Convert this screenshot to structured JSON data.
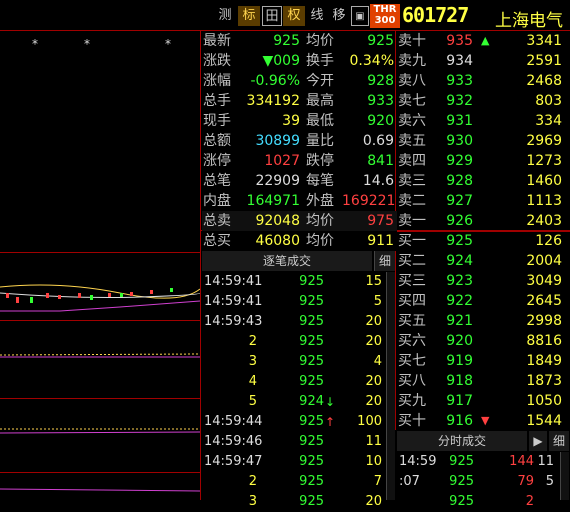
{
  "toolbar": {
    "buttons": [
      "测",
      "标",
      "田",
      "权",
      "线",
      "移",
      "▣",
      "▣"
    ],
    "index_badge": "THR\n300",
    "code": "601727",
    "name": "上海电气"
  },
  "chart": {
    "markers": [
      "*",
      "*",
      "*"
    ]
  },
  "quote_left": [
    {
      "l1": "最新",
      "v1": "925",
      "c1": "green",
      "l2": "均价",
      "v2": "925",
      "c2": "green"
    },
    {
      "l1": "涨跌",
      "v1": "▼009",
      "c1": "green",
      "l2": "换手",
      "v2": "0.34%",
      "c2": "yellow"
    },
    {
      "l1": "涨幅",
      "v1": "-0.96%",
      "c1": "green",
      "l2": "今开",
      "v2": "928",
      "c2": "green"
    },
    {
      "l1": "总手",
      "v1": "334192",
      "c1": "yellow",
      "l2": "最高",
      "v2": "933",
      "c2": "green"
    },
    {
      "l1": "现手",
      "v1": "39",
      "c1": "yellow",
      "l2": "最低",
      "v2": "920",
      "c2": "green"
    },
    {
      "l1": "总额",
      "v1": "30899",
      "c1": "cyan",
      "l2": "量比",
      "v2": "0.69",
      "c2": "white"
    },
    {
      "l1": "涨停",
      "v1": "1027",
      "c1": "red",
      "l2": "跌停",
      "v2": "841",
      "c2": "green"
    },
    {
      "l1": "总笔",
      "v1": "22909",
      "c1": "white",
      "l2": "每笔",
      "v2": "14.6",
      "c2": "white"
    },
    {
      "l1": "内盘",
      "v1": "164971",
      "c1": "green",
      "l2": "外盘",
      "v2": "169221",
      "c2": "red"
    },
    {
      "l1": "总卖",
      "v1": "92048",
      "c1": "yellow",
      "l2": "均价",
      "v2": "975",
      "c2": "red"
    },
    {
      "l1": "总买",
      "v1": "46080",
      "c1": "yellow",
      "l2": "均价",
      "v2": "911",
      "c2": "yellow"
    }
  ],
  "orders": [
    {
      "label": "卖十",
      "price": "935",
      "pc": "red",
      "arrow": "▲",
      "vol": "3341"
    },
    {
      "label": "卖九",
      "price": "934",
      "pc": "white",
      "arrow": "",
      "vol": "2591"
    },
    {
      "label": "卖八",
      "price": "933",
      "pc": "green",
      "arrow": "",
      "vol": "2468"
    },
    {
      "label": "卖七",
      "price": "932",
      "pc": "green",
      "arrow": "",
      "vol": "803"
    },
    {
      "label": "卖六",
      "price": "931",
      "pc": "green",
      "arrow": "",
      "vol": "334"
    },
    {
      "label": "卖五",
      "price": "930",
      "pc": "green",
      "arrow": "",
      "vol": "2969"
    },
    {
      "label": "卖四",
      "price": "929",
      "pc": "green",
      "arrow": "",
      "vol": "1273"
    },
    {
      "label": "卖三",
      "price": "928",
      "pc": "green",
      "arrow": "",
      "vol": "1460"
    },
    {
      "label": "卖二",
      "price": "927",
      "pc": "green",
      "arrow": "",
      "vol": "1113"
    },
    {
      "label": "卖一",
      "price": "926",
      "pc": "green",
      "arrow": "",
      "vol": "2403"
    },
    {
      "label": "买一",
      "price": "925",
      "pc": "green",
      "arrow": "",
      "vol": "126"
    },
    {
      "label": "买二",
      "price": "924",
      "pc": "green",
      "arrow": "",
      "vol": "2004"
    },
    {
      "label": "买三",
      "price": "923",
      "pc": "green",
      "arrow": "",
      "vol": "3049"
    },
    {
      "label": "买四",
      "price": "922",
      "pc": "green",
      "arrow": "",
      "vol": "2645"
    },
    {
      "label": "买五",
      "price": "921",
      "pc": "green",
      "arrow": "",
      "vol": "2998"
    },
    {
      "label": "买六",
      "price": "920",
      "pc": "green",
      "arrow": "",
      "vol": "8816"
    },
    {
      "label": "买七",
      "price": "919",
      "pc": "green",
      "arrow": "",
      "vol": "1849"
    },
    {
      "label": "买八",
      "price": "918",
      "pc": "green",
      "arrow": "",
      "vol": "1873"
    },
    {
      "label": "买九",
      "price": "917",
      "pc": "green",
      "arrow": "",
      "vol": "1050"
    },
    {
      "label": "买十",
      "price": "916",
      "pc": "green",
      "arrow": "▼",
      "vol": "1544"
    }
  ],
  "ticks_header": {
    "title": "逐笔成交",
    "btn": "细"
  },
  "ticks": [
    {
      "time": "14:59:41",
      "price": "925",
      "arrow": "",
      "vol": "15"
    },
    {
      "time": "14:59:41",
      "price": "925",
      "arrow": "",
      "vol": "5"
    },
    {
      "time": "14:59:43",
      "price": "925",
      "arrow": "",
      "vol": "20"
    },
    {
      "time": "2",
      "price": "925",
      "arrow": "",
      "vol": "20"
    },
    {
      "time": "3",
      "price": "925",
      "arrow": "",
      "vol": "4"
    },
    {
      "time": "4",
      "price": "925",
      "arrow": "",
      "vol": "20"
    },
    {
      "time": "5",
      "price": "924",
      "arrow": "↓",
      "vol": "20"
    },
    {
      "time": "14:59:44",
      "price": "925",
      "arrow": "↑",
      "vol": "100"
    },
    {
      "time": "14:59:46",
      "price": "925",
      "arrow": "",
      "vol": "11"
    },
    {
      "time": "14:59:47",
      "price": "925",
      "arrow": "",
      "vol": "10"
    },
    {
      "time": "2",
      "price": "925",
      "arrow": "",
      "vol": "7"
    },
    {
      "time": "3",
      "price": "925",
      "arrow": "",
      "vol": "20"
    }
  ],
  "minute_header": {
    "title": "分时成交",
    "btn1": "▶",
    "btn2": "细"
  },
  "minute": [
    {
      "time": "14:59",
      "price": "925",
      "vol": "144",
      "c": "11"
    },
    {
      "time": ":07",
      "price": "925",
      "vol": "79",
      "c": "5"
    },
    {
      "time": "",
      "price": "925",
      "vol": "2",
      "c": ""
    }
  ]
}
